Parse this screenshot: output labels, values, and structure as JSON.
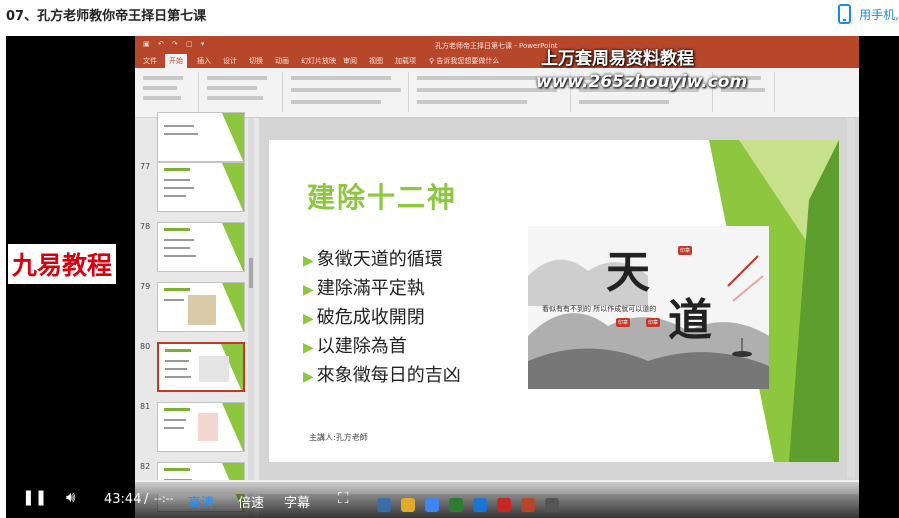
{
  "page": {
    "title": "07、孔方老师教你帝王择日第七课",
    "phone_label": "用手机,"
  },
  "watermarks": {
    "top": "上万套周易资料教程",
    "url": "www.265zhouyiw.com",
    "left": "九易教程"
  },
  "ppt": {
    "window_title": "孔方老师帝王择日第七课 - PowerPoint",
    "tabs": [
      "文件",
      "开始",
      "插入",
      "设计",
      "切换",
      "动画",
      "幻灯片放映",
      "审阅",
      "视图",
      "加载项",
      "♀ 告诉我您想要做什么"
    ],
    "thumb_numbers": [
      "77",
      "78",
      "79",
      "80",
      "81",
      "82"
    ]
  },
  "slide": {
    "title": "建除十二神",
    "bullets": [
      "象徵天道的循環",
      "建除滿平定執",
      "破危成收開閉",
      "以建除為首",
      "來象徵每日的吉凶"
    ],
    "footer": "主講人:孔方老師",
    "art_big_1": "天",
    "art_big_2": "道"
  },
  "player": {
    "time": "43:44",
    "separator": "/",
    "duration": "--:--",
    "quality": "高清",
    "speed": "倍速",
    "subtitle": "字幕"
  },
  "colors": {
    "accent_green": "#8dc63f",
    "ppt_red": "#b7472a",
    "link_blue": "#1e88e5"
  }
}
